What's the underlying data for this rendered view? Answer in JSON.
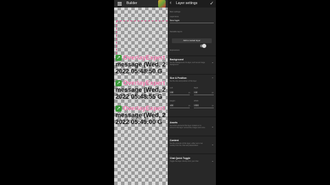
{
  "builder": {
    "title": "Builder",
    "entries": [
      {
        "name": "OverlayExpert",
        "message_line1": "message (Wed, 2",
        "message_line2": "2022 05:48:50 G"
      },
      {
        "name": "OverlayExpert",
        "message_line1": "message (Wed, 2",
        "message_line2": "2022 05:48:55 G"
      },
      {
        "name": "OverlayExpert",
        "message_line1": "message (Wed, 2",
        "message_line2": "2022 05:49:00 G"
      }
    ]
  },
  "settings": {
    "title": "Layer settings",
    "section_top": "Main settings",
    "name_label": "Layername",
    "name_value": "New layer",
    "nested_label": "Nestable layers",
    "add_nested_button": "Add a nested layer",
    "expressions_label": "Expressions",
    "background": {
      "title": "Background",
      "desc": "Set the background of a layer, such as an image background"
    },
    "size_position": {
      "title": "Size & Position",
      "desc": "Set the size and position of this layer",
      "left_label": "Left",
      "left_value": "100",
      "left_unit": "px",
      "right_label": "Right",
      "right_value": "100",
      "right_unit": "px",
      "height_label": "Height",
      "height_value": "400",
      "height_unit": "px",
      "width_label": "Width",
      "width_value": "1920",
      "width_unit": "px"
    },
    "assets": {
      "title": "Assets",
      "desc": "Set which elements this layer contains or is stored in this layer content like images and more"
    },
    "content": {
      "title": "Content",
      "desc": "Set the contents of this layer, either text or an overlay from the chat and placeholders"
    },
    "chat_quick_toggle": {
      "title": "Chat Quick Toggle",
      "desc": "Toggle this layer directly from your chat"
    }
  }
}
